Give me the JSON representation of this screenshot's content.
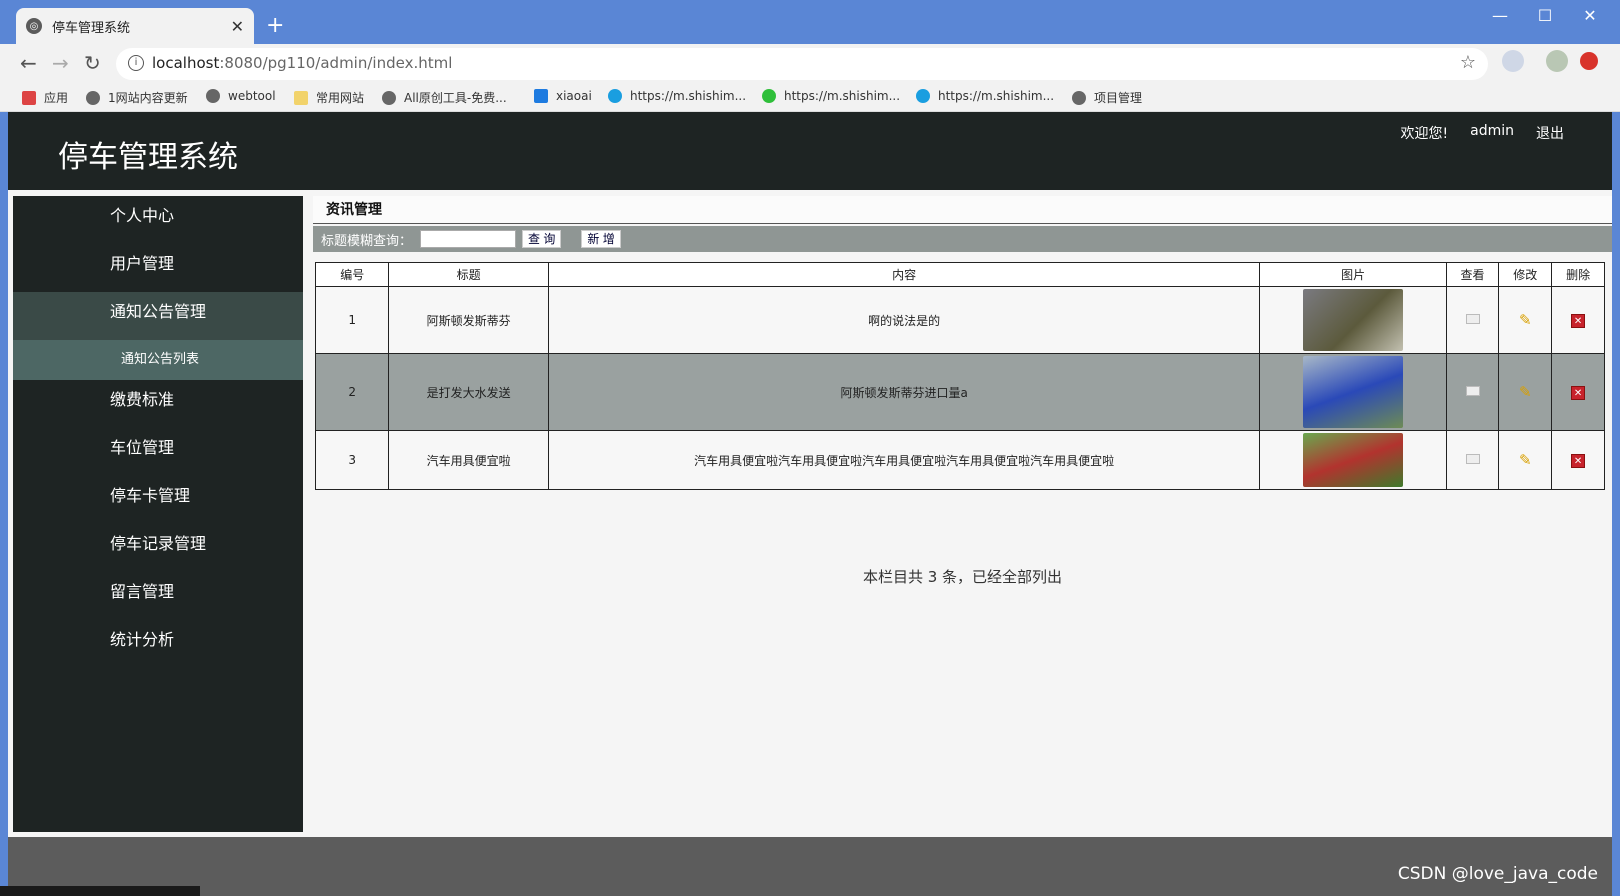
{
  "browser": {
    "tab_title": "停车管理系统",
    "tab_close": "✕",
    "new_tab": "+",
    "url_host": "localhost",
    "url_rest": ":8080/pg110/admin/index.html",
    "window_min": "—",
    "window_max": "☐",
    "window_close": "✕",
    "bookmarks": [
      {
        "label": "应用"
      },
      {
        "label": "1网站内容更新"
      },
      {
        "label": "webtool"
      },
      {
        "label": "常用网站"
      },
      {
        "label": "All原创工具-免费..."
      },
      {
        "label": "xiaoai"
      },
      {
        "label": "https://m.shishim..."
      },
      {
        "label": "https://m.shishim..."
      },
      {
        "label": "https://m.shishim..."
      },
      {
        "label": "项目管理"
      }
    ]
  },
  "header": {
    "site_title": "停车管理系统",
    "welcome": "欢迎您!",
    "user": "admin",
    "logout": "退出"
  },
  "sidebar": {
    "items": [
      {
        "label": "个人中心"
      },
      {
        "label": "用户管理"
      },
      {
        "label": "通知公告管理"
      },
      {
        "label": "通知公告列表"
      },
      {
        "label": "缴费标准"
      },
      {
        "label": "车位管理"
      },
      {
        "label": "停车卡管理"
      },
      {
        "label": "停车记录管理"
      },
      {
        "label": "留言管理"
      },
      {
        "label": "统计分析"
      }
    ]
  },
  "main": {
    "breadcrumb": "资讯管理",
    "search_label": "标题模糊查询：",
    "search_value": "",
    "query_button": "查 询",
    "add_button": "新 增",
    "columns": [
      "编号",
      "标题",
      "内容",
      "图片",
      "查看",
      "修改",
      "删除"
    ],
    "rows": [
      {
        "id": "1",
        "title": "阿斯顿发斯蒂芬",
        "content": "啊的说法是的",
        "img_color": "#6b6a52"
      },
      {
        "id": "2",
        "title": "是打发大水发送",
        "content": "阿斯顿发斯蒂芬进口量a",
        "img_color": "#2a49b8"
      },
      {
        "id": "3",
        "title": "汽车用具便宜啦",
        "content": "汽车用具便宜啦汽车用具便宜啦汽车用具便宜啦汽车用具便宜啦汽车用具便宜啦",
        "img_color": "#b2332e"
      }
    ],
    "summary": "本栏目共 3 条，已经全部列出"
  },
  "watermark": "CSDN @love_java_code"
}
